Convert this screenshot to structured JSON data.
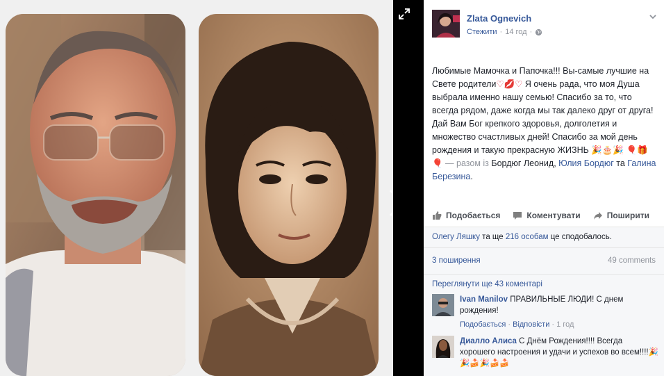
{
  "viewer": {
    "expand_icon": "expand-arrows-icon",
    "next_icon": "chevron-right-icon"
  },
  "post": {
    "author": "Zlata Ognevich",
    "follow_label": "Стежити",
    "time": "14 год",
    "privacy_icon": "globe-icon",
    "text": {
      "line_a": "Любимые Мамочка и Папочка!!! Вы-самые лучшие на Свете родители",
      "line_b": " Я очень рада, что моя Душа выбрала именно нашу семью! Спасибо за то, что всегда рядом, даже когда мы так далеко друг от друга! Дай Вам Бог крепкого здоровья, долголетия и множество счастливых дней! Спасибо за мой день рождения и такую прекрасную ЖИЗНЬ",
      "with_label": " — разом із ",
      "tag_1": "Бордюг Леонид",
      "sep_1": ", ",
      "tag_2": "Юлия Бордюг",
      "sep_2": " та ",
      "tag_3": "Галина Березина",
      "end": "."
    }
  },
  "actions": {
    "like": "Подобається",
    "comment": "Коментувати",
    "share": "Поширити"
  },
  "likes": {
    "name": "Олегу Ляшку",
    "and": " та ще ",
    "others": "216 особам",
    "suffix": " це сподобалось."
  },
  "shares": {
    "count_label": "3 поширення",
    "comments_label": "49 comments"
  },
  "comments": {
    "view_more": "Переглянути ще 43 коментарі",
    "items": [
      {
        "name": "Ivan Manilov",
        "text": " ПРАВИЛЬНЫЕ ЛЮДИ! С днем рождения!",
        "like": "Подобається",
        "dot": " · ",
        "reply": "Відповісти",
        "time": "1 год"
      },
      {
        "name": "Диалло Алиса",
        "text": " С Днём Рождения!!!! Всегда хорошего настроения и удачи и успехов во всем!!!!"
      }
    ]
  },
  "colors": {
    "link": "#365899",
    "muted": "#90949c",
    "panel": "#f6f7f9"
  }
}
